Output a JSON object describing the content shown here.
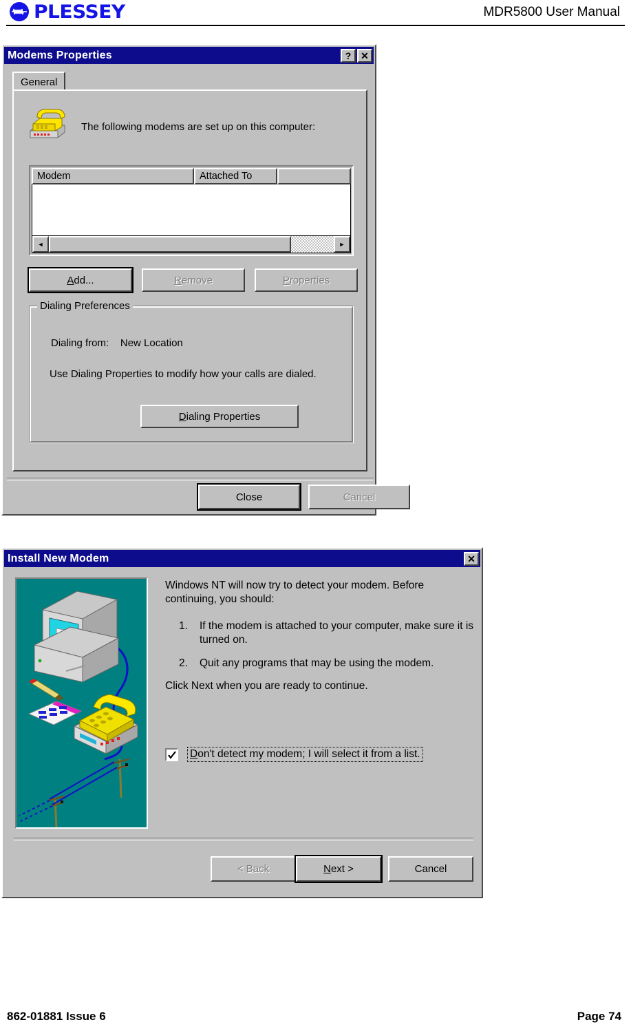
{
  "page": {
    "manual_title": "MDR5800 User Manual",
    "brand": "PLESSEY",
    "brand_color": "#1414e6",
    "footer_doc_id": "862-01881 Issue 6",
    "footer_page": "Page 74"
  },
  "modems_properties": {
    "title": "Modems Properties",
    "titlebar_help": "?",
    "titlebar_close": "✕",
    "tabs": [
      {
        "label": "General",
        "selected": true
      }
    ],
    "intro_text": "The following modems are set up on this computer:",
    "intro_icon": "modem-phone-icon",
    "list": {
      "columns": [
        "Modem",
        "Attached To",
        ""
      ],
      "rows": [],
      "scroll_left_arrow": "◄",
      "scroll_right_arrow": "►"
    },
    "buttons": [
      {
        "label": "Add...",
        "accel": "A",
        "enabled": true,
        "default": true
      },
      {
        "label": "Remove",
        "accel": "R",
        "enabled": false,
        "default": false
      },
      {
        "label": "Properties",
        "accel": "P",
        "enabled": false,
        "default": false
      }
    ],
    "dialing_preferences": {
      "group_label": "Dialing Preferences",
      "dialing_from_label": "Dialing from:",
      "dialing_from_value": "New Location",
      "hint": "Use Dialing Properties to modify how your calls are dialed.",
      "button_label": "Dialing Properties",
      "button_accel": "D"
    },
    "footer_buttons": [
      {
        "label": "Close",
        "enabled": true,
        "default": true
      },
      {
        "label": "Cancel",
        "enabled": false,
        "default": false
      }
    ]
  },
  "install_new_modem": {
    "title": "Install New Modem",
    "titlebar_close": "✕",
    "artwork_name": "computer-telephone-line-illustration",
    "artwork_background": "#008080",
    "intro": "Windows NT will now try to detect your modem.  Before continuing, you should:",
    "steps": [
      {
        "number": "1.",
        "text": "If the modem is attached to your computer, make sure it is turned on."
      },
      {
        "number": "2.",
        "text": "Quit any programs that may be using the modem."
      }
    ],
    "click_next": "Click Next when you are ready to continue.",
    "checkbox": {
      "label": "Don't detect my modem; I will select it from a list.",
      "accel": "D",
      "checked": true,
      "focused": true
    },
    "buttons": [
      {
        "label": "< Back",
        "accel": "B",
        "enabled": false,
        "default": false
      },
      {
        "label": "Next >",
        "accel": "N",
        "enabled": true,
        "default": true
      },
      {
        "label": "Cancel",
        "accel": "",
        "enabled": true,
        "default": false
      }
    ]
  }
}
